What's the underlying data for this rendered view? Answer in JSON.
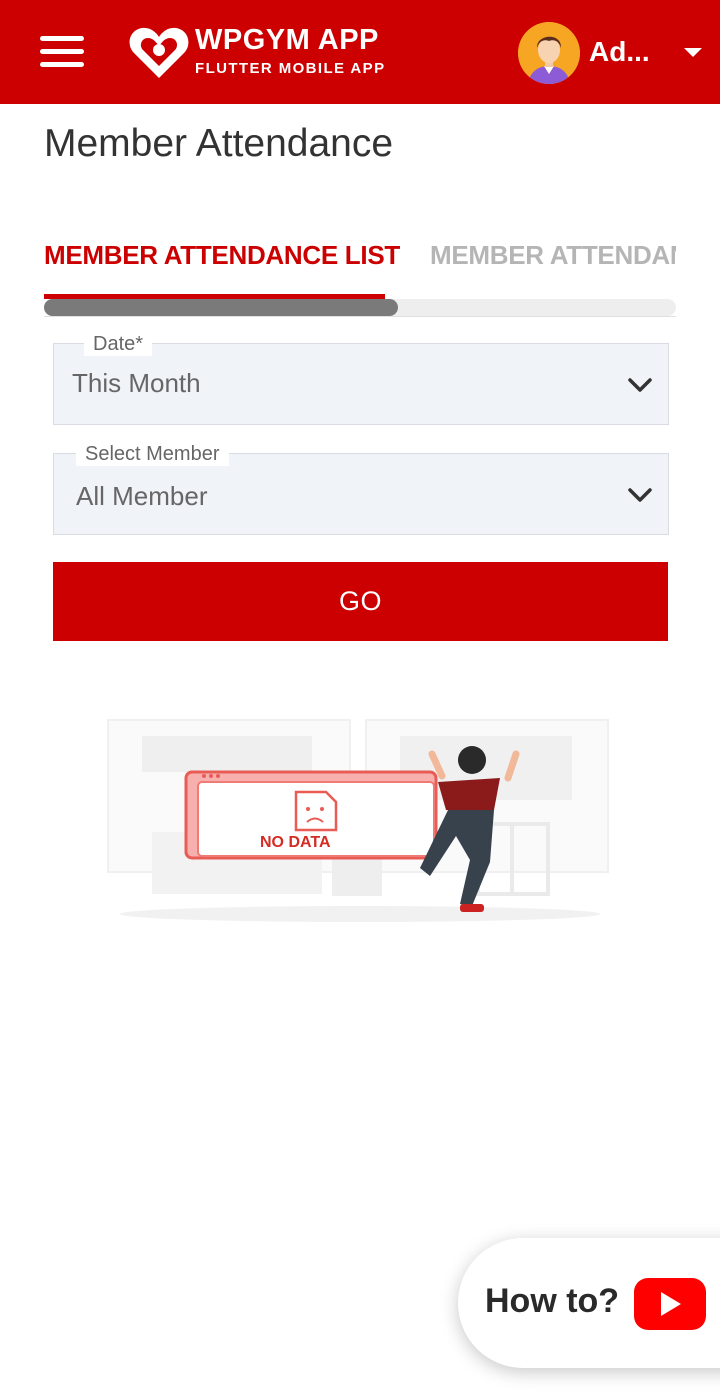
{
  "header": {
    "brand_title": "WPGYM APP",
    "brand_subtitle": "FLUTTER MOBILE APP",
    "user_name": "Ad...",
    "bar_color": "#cc0000"
  },
  "page": {
    "title": "Member Attendance"
  },
  "tabs": [
    {
      "label": "MEMBER ATTENDANCE LIST",
      "active": true
    },
    {
      "label": "MEMBER ATTENDANCE",
      "active": false
    }
  ],
  "tab_scroll_progress": 0.56,
  "form": {
    "date": {
      "label": "Date*",
      "value": "This Month"
    },
    "member": {
      "label": "Select Member",
      "value": "All Member"
    },
    "go_label": "GO"
  },
  "empty_state": {
    "image_text": "NO DATA"
  },
  "help": {
    "label": "How to?",
    "icon": "youtube-play-icon"
  }
}
